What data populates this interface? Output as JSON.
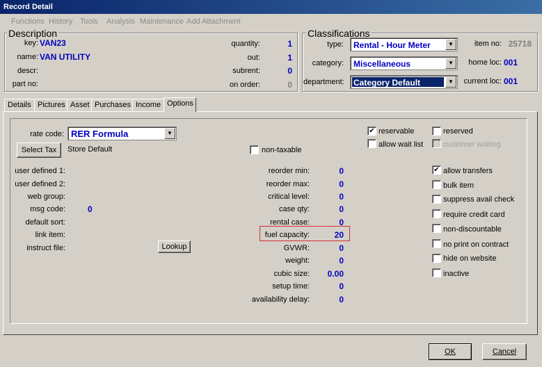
{
  "window": {
    "title": "Record Detail"
  },
  "menu": [
    "Functions",
    "History",
    "Tools",
    "Analysis",
    "Maintenance",
    "Add Attachment"
  ],
  "description": {
    "title": "Description",
    "key_label": "key:",
    "key": "VAN23",
    "name_label": "name:",
    "name": "VAN UTILITY",
    "descr_label": "descr:",
    "partno_label": "part no:",
    "quantity_label": "quantity:",
    "quantity": "1",
    "out_label": "out:",
    "out": "1",
    "subrent_label": "subrent:",
    "subrent": "0",
    "onorder_label": "on order:",
    "onorder": "0"
  },
  "classifications": {
    "title": "Classifications",
    "type_label": "type:",
    "type": "Rental - Hour Meter",
    "category_label": "category:",
    "category": "Miscellaneous",
    "department_label": "department:",
    "department": "Category Default",
    "itemno_label": "item no:",
    "itemno": "25718",
    "homeloc_label": "home loc:",
    "homeloc": "001",
    "currentloc_label": "current loc:",
    "currentloc": "001"
  },
  "tabs": [
    "Details",
    "Pictures",
    "Asset",
    "Purchases",
    "Income",
    "Options"
  ],
  "options": {
    "rate_code_label": "rate code:",
    "rate_code": "RER Formula",
    "select_tax_label": "Select Tax",
    "tax_value": "Store Default",
    "non_taxable_label": "non-taxable",
    "user_defined_1_label": "user defined 1:",
    "user_defined_2_label": "user defined 2:",
    "web_group_label": "web group:",
    "msg_code_label": "msg code:",
    "msg_code": "0",
    "default_sort_label": "default sort:",
    "link_item_label": "link item:",
    "instruct_file_label": "instruct file:",
    "lookup_label": "Lookup",
    "reorder_min_label": "reorder min:",
    "reorder_min": "0",
    "reorder_max_label": "reorder max:",
    "reorder_max": "0",
    "critical_level_label": "critical level:",
    "critical_level": "0",
    "case_qty_label": "case qty:",
    "case_qty": "0",
    "rental_case_label": "rental case:",
    "rental_case": "0",
    "fuel_capacity_label": "fuel capacity:",
    "fuel_capacity": "20",
    "gvwr_label": "GVWR:",
    "gvwr": "0",
    "weight_label": "weight:",
    "weight": "0",
    "cubic_size_label": "cubic size:",
    "cubic_size": "0.00",
    "setup_time_label": "setup time:",
    "setup_time": "0",
    "availability_delay_label": "availability delay:",
    "availability_delay": "0",
    "reservable_label": "reservable",
    "allow_wait_list_label": "allow wait list",
    "reserved_label": "reserved",
    "customer_waiting_label": "customer waiting",
    "allow_transfers_label": "allow transfers",
    "bulk_item_label": "bulk item",
    "suppress_avail_check_label": "suppress avail check",
    "require_credit_card_label": "require credit card",
    "non_discountable_label": "non-discountable",
    "no_print_on_contract_label": "no print on contract",
    "hide_on_website_label": "hide on website",
    "inactive_label": "inactive"
  },
  "buttons": {
    "ok": "OK",
    "cancel": "Cancel"
  }
}
